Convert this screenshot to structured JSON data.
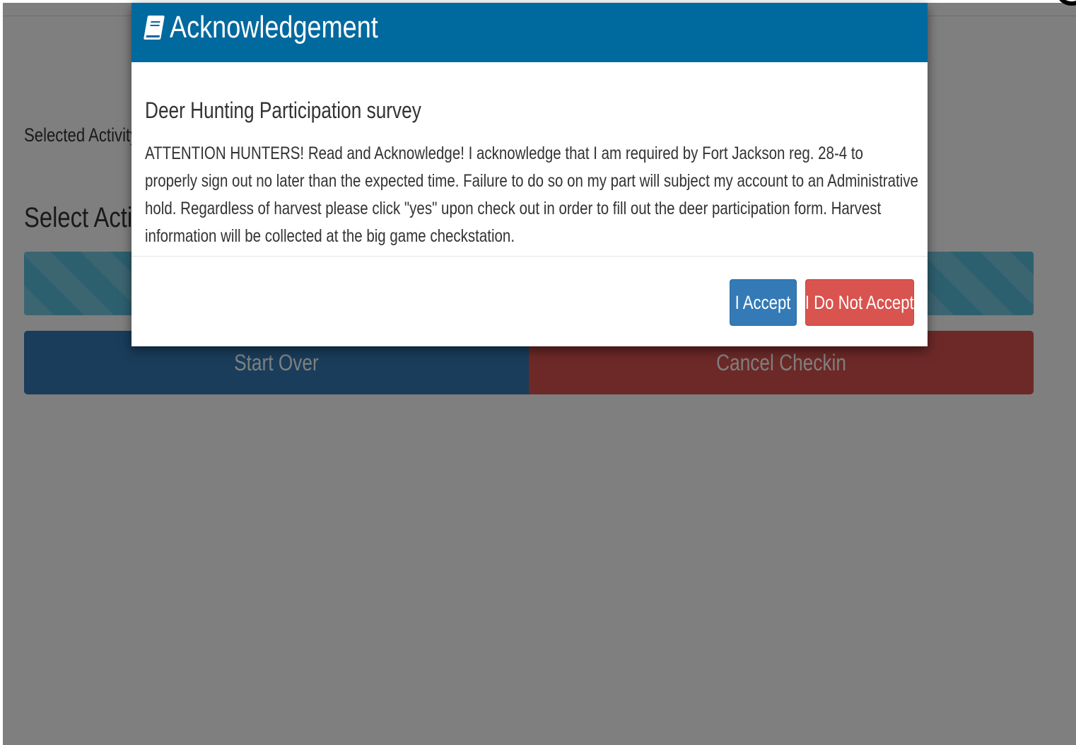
{
  "page": {
    "selected_activity_label": "Selected Activity",
    "select_activity_heading": "Select Activity",
    "start_over_label": "Start Over",
    "cancel_checkin_label": "Cancel Checkin"
  },
  "modal": {
    "title": "Acknowledgement",
    "title_icon": "book-icon",
    "survey_title": "Deer Hunting Participation survey",
    "notice": "ATTENTION HUNTERS!  Read and Acknowledge!  I acknowledge that I am required by Fort Jackson reg. 28-4 to properly sign out no later than the expected time.  Failure to do so on my part will subject my account to an Administrative hold.  Regardless of harvest please click \"yes\" upon check out in order to fill out the deer participation form.  Harvest information will be collected at the big game checkstation.",
    "accept_label": "I Accept",
    "decline_label": "I Do Not Accept"
  },
  "colors": {
    "modal_header": "#00699e",
    "primary": "#337ab7",
    "danger": "#d9534f",
    "info": "#5bc0de"
  }
}
